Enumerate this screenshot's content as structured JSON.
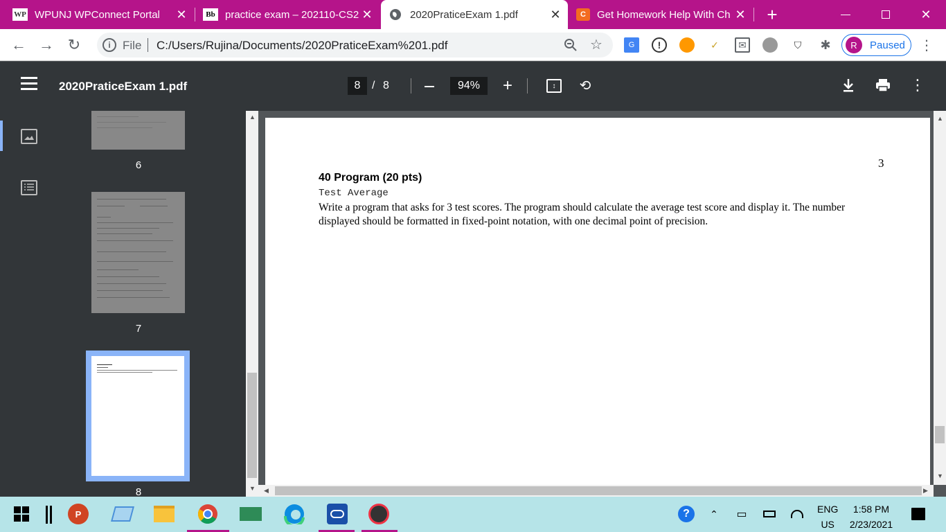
{
  "browser": {
    "tabs": [
      {
        "icon": "WP",
        "title": "WPUNJ WPConnect Portal",
        "active": false
      },
      {
        "icon": "Bb",
        "title": "practice exam – 202110-CS2",
        "active": false
      },
      {
        "icon": "globe",
        "title": "2020PraticeExam 1.pdf",
        "active": true
      },
      {
        "icon": "C",
        "title": "Get Homework Help With Ch",
        "active": false
      }
    ],
    "new_tab": "+",
    "url_scheme": "File",
    "url": "C:/Users/Rujina/Documents/2020PraticeExam%201.pdf",
    "profile_initial": "R",
    "profile_status": "Paused",
    "accent_color": "#b5148a"
  },
  "pdf": {
    "title": "2020PraticeExam 1.pdf",
    "current_page": "8",
    "page_separator": "/",
    "total_pages": "8",
    "zoom": "94%",
    "thumbnails": [
      {
        "label": "6"
      },
      {
        "label": "7"
      },
      {
        "label": "8",
        "selected": true
      }
    ],
    "page": {
      "number": "3",
      "heading": "40 Program (20 pts)",
      "subheading": "Test Average",
      "body": "Write a program that asks for 3 test scores. The program should calculate the average test score and display it. The number displayed should be formatted in fixed-point notation, with one decimal point of precision."
    }
  },
  "taskbar": {
    "language_line1": "ENG",
    "language_line2": "US",
    "time": "1:58 PM",
    "date": "2/23/2021"
  }
}
